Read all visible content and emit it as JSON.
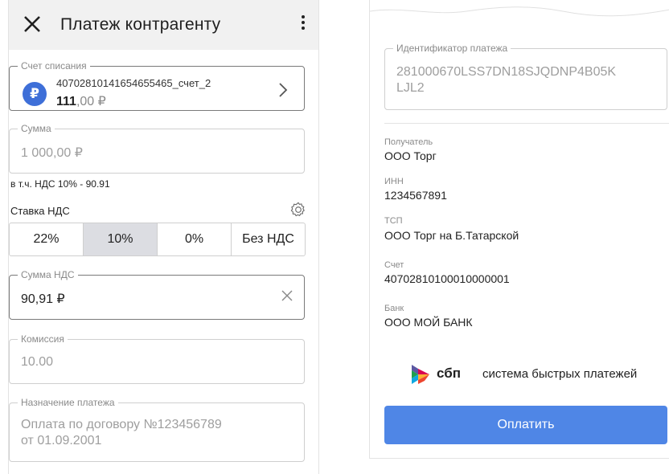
{
  "left": {
    "title": "Платеж контрагенту",
    "account": {
      "label": "Счет списания",
      "currency_symbol": "₽",
      "number": "40702810141654655465_счет_2",
      "amount_int": "111",
      "amount_frac": ",00 ₽"
    },
    "sum": {
      "label": "Сумма",
      "value": "1 000,00 ₽"
    },
    "vat_note": "в т.ч. НДС 10% - 90.91",
    "vat_rate_label": "Ставка НДС",
    "vat_rates": [
      "22%",
      "10%",
      "0%",
      "Без НДС"
    ],
    "vat_selected_index": 1,
    "vat_sum": {
      "label": "Сумма НДС",
      "value": "90,91 ₽"
    },
    "commission": {
      "label": "Комиссия",
      "value": "10.00"
    },
    "purpose": {
      "label": "Назначение платежа",
      "line1": "Оплата по договору №123456789",
      "line2": "от 01.09.2001"
    }
  },
  "right": {
    "payment_id": {
      "label": "Идентификатор платежа",
      "line1": "281000670LSS7DN18SJQDNP4B05K",
      "line2": "LJL2"
    },
    "recipient": {
      "label": "Получатель",
      "value": "ООО Торг"
    },
    "inn": {
      "label": "ИНН",
      "value": "1234567891"
    },
    "tsp": {
      "label": "ТСП",
      "value": "ООО Торг на Б.Татарской"
    },
    "account": {
      "label": "Счет",
      "value": "40702810100010000001"
    },
    "bank": {
      "label": "Банк",
      "value": "ООО МОЙ БАНК"
    },
    "sbp": {
      "word": "сбп",
      "text": "система быстрых платежей"
    },
    "pay_button": "Оплатить"
  },
  "colors": {
    "accent": "#4f86e6",
    "ruble_icon": "#3e6fd8",
    "selected_segment": "#dcdde2"
  }
}
